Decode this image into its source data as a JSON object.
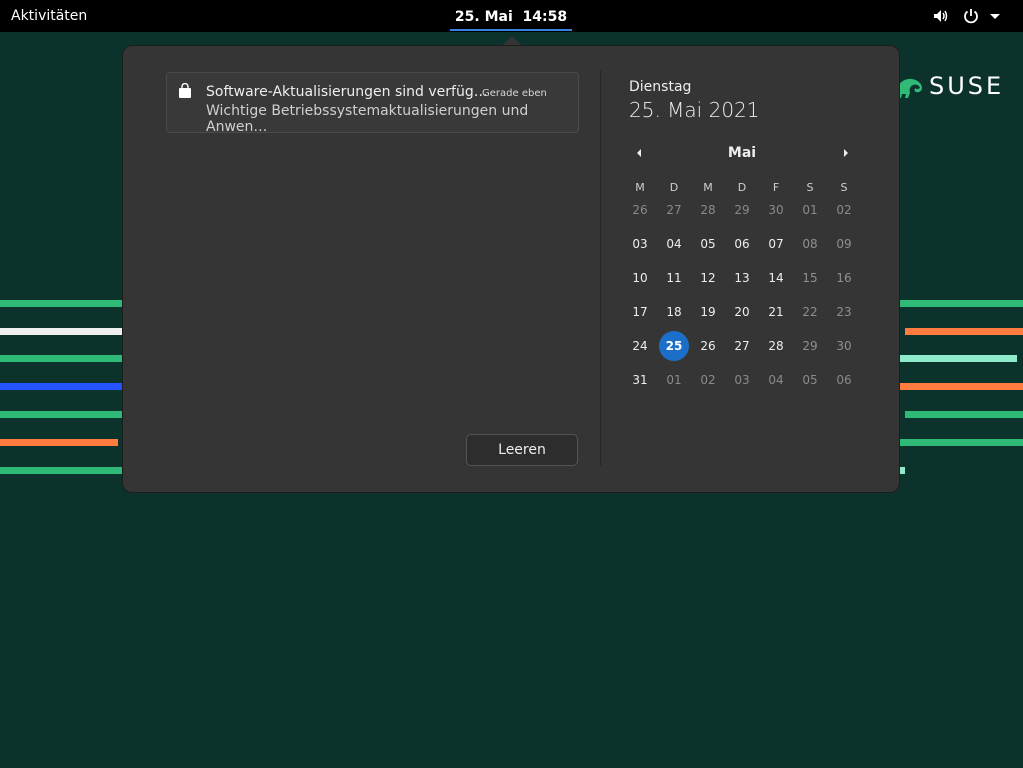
{
  "topbar": {
    "activities_label": "Aktivitäten",
    "clock": "25. Mai  14:58",
    "icons": [
      "volume-icon",
      "power-icon",
      "chevron-down-icon"
    ]
  },
  "wallpaper": {
    "brand": "SUSE",
    "background_color": "#0b332b",
    "stripe_colors": [
      "#30ba78",
      "#efefef",
      "#2453ff",
      "#fe7c3f",
      "#90ebcd"
    ]
  },
  "notifications": {
    "items": [
      {
        "icon": "shopping-bag-icon",
        "title": "Software-Aktualisierungen sind verfüg…",
        "time": "Gerade eben",
        "body": "Wichtige Betriebssystemaktualisierungen und Anwen…"
      }
    ],
    "clear_label": "Leeren"
  },
  "calendar": {
    "weekday": "Dienstag",
    "date": "25. Mai 2021",
    "month": "Mai",
    "weekday_headers": [
      "M",
      "D",
      "M",
      "D",
      "F",
      "S",
      "S"
    ],
    "weeks": [
      [
        "26",
        "27",
        "28",
        "29",
        "30",
        "01",
        "02"
      ],
      [
        "03",
        "04",
        "05",
        "06",
        "07",
        "08",
        "09"
      ],
      [
        "10",
        "11",
        "12",
        "13",
        "14",
        "15",
        "16"
      ],
      [
        "17",
        "18",
        "19",
        "20",
        "21",
        "22",
        "23"
      ],
      [
        "24",
        "25",
        "26",
        "27",
        "28",
        "29",
        "30"
      ],
      [
        "31",
        "01",
        "02",
        "03",
        "04",
        "05",
        "06"
      ]
    ],
    "selected_day": "25",
    "accent_color": "#1c6fc9"
  }
}
